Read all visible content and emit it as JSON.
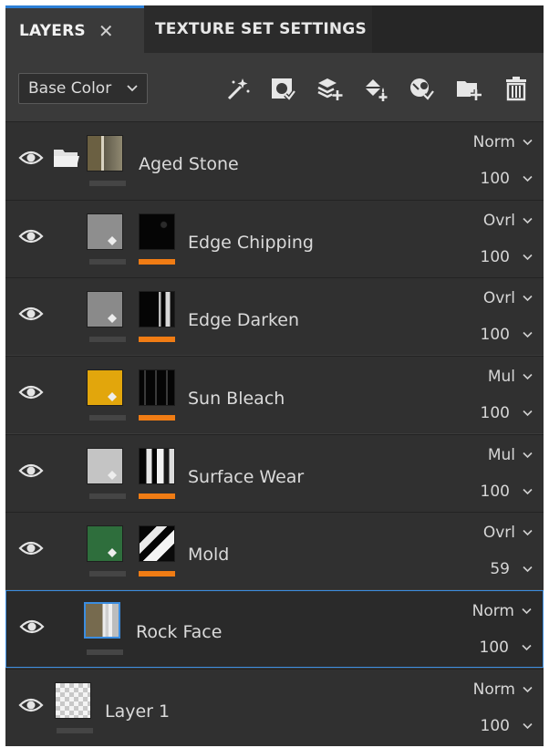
{
  "tabs": {
    "layers": "LAYERS",
    "close": "✕",
    "texture_set_settings": "TEXTURE SET SETTINGS"
  },
  "toolbar": {
    "channel": "Base Color",
    "icons": [
      "add-effect-icon",
      "add-mask-icon",
      "add-fill-layer-icon",
      "add-paint-layer-icon",
      "add-smart-material-icon",
      "add-folder-icon",
      "delete-icon"
    ]
  },
  "layers": [
    {
      "name": "Aged Stone",
      "blend": "Norm",
      "opacity": "100",
      "type": "folder"
    },
    {
      "name": "Edge Chipping",
      "blend": "Ovrl",
      "opacity": "100",
      "color": "#8e8e8e"
    },
    {
      "name": "Edge Darken",
      "blend": "Ovrl",
      "opacity": "100",
      "color": "#8a8a8a"
    },
    {
      "name": "Sun Bleach",
      "blend": "Mul",
      "opacity": "100",
      "color": "#e2a60c"
    },
    {
      "name": "Surface Wear",
      "blend": "Mul",
      "opacity": "100",
      "color": "#c4c4c4"
    },
    {
      "name": "Mold",
      "blend": "Ovrl",
      "opacity": "59",
      "color": "#2e6e3c"
    },
    {
      "name": "Rock Face",
      "blend": "Norm",
      "opacity": "100",
      "selected": true
    },
    {
      "name": "Layer 1",
      "blend": "Norm",
      "opacity": "100"
    }
  ],
  "colors": {
    "accent": "#3b8de0",
    "mask_bar": "#f07c14",
    "panel": "#3a3a3a"
  }
}
